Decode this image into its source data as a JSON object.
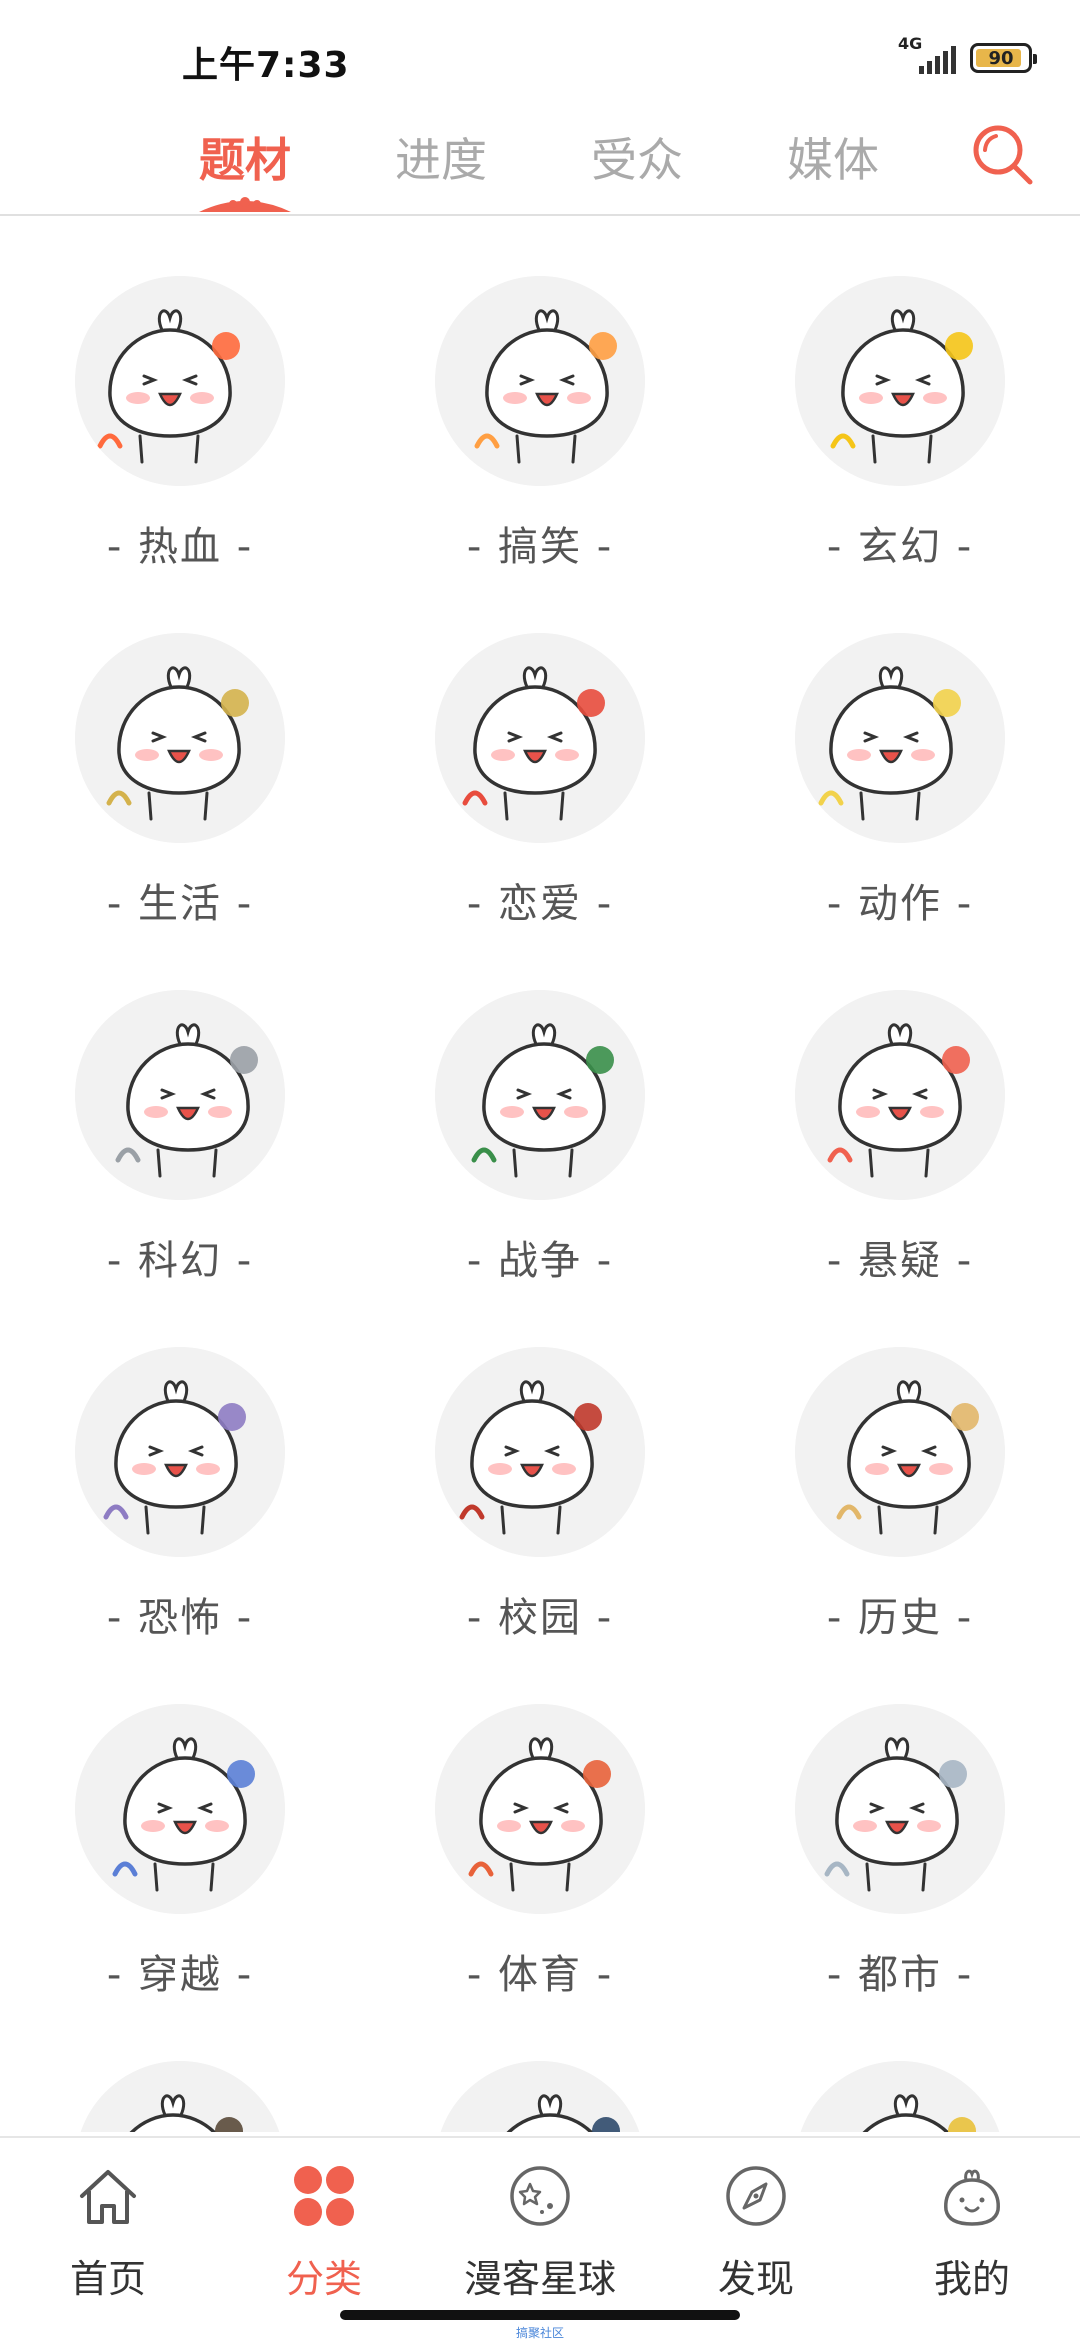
{
  "status_bar": {
    "time": "上午7:33",
    "network": "4G",
    "battery": "90",
    "battery_level": 0.9
  },
  "tabs": [
    {
      "label": "题材",
      "active": true
    },
    {
      "label": "进度",
      "active": false
    },
    {
      "label": "受众",
      "active": false
    },
    {
      "label": "媒体",
      "active": false
    }
  ],
  "colors": {
    "accent": "#f0614f",
    "tab_inactive": "#aaaaaa",
    "label": "#555555",
    "avatar_bg": "#f2f2f2"
  },
  "categories": [
    {
      "label": "- 热血 -",
      "icon": "hot-blooded-mascot-icon"
    },
    {
      "label": "- 搞笑 -",
      "icon": "comedy-mascot-icon"
    },
    {
      "label": "- 玄幻 -",
      "icon": "fantasy-mascot-icon"
    },
    {
      "label": "- 生活 -",
      "icon": "daily-life-mascot-icon"
    },
    {
      "label": "- 恋爱 -",
      "icon": "romance-mascot-icon"
    },
    {
      "label": "- 动作 -",
      "icon": "action-mascot-icon"
    },
    {
      "label": "- 科幻 -",
      "icon": "scifi-mascot-icon"
    },
    {
      "label": "- 战争 -",
      "icon": "war-mascot-icon"
    },
    {
      "label": "- 悬疑 -",
      "icon": "mystery-mascot-icon"
    },
    {
      "label": "- 恐怖 -",
      "icon": "horror-mascot-icon"
    },
    {
      "label": "- 校园 -",
      "icon": "campus-mascot-icon"
    },
    {
      "label": "- 历史 -",
      "icon": "history-mascot-icon"
    },
    {
      "label": "- 穿越 -",
      "icon": "time-travel-mascot-icon"
    },
    {
      "label": "- 体育 -",
      "icon": "sports-mascot-icon"
    },
    {
      "label": "- 都市 -",
      "icon": "urban-mascot-icon"
    },
    {
      "label": "",
      "icon": "partial-mascot-icon"
    },
    {
      "label": "",
      "icon": "partial-mascot-icon"
    },
    {
      "label": "",
      "icon": "partial-mascot-icon"
    }
  ],
  "bottom_nav": [
    {
      "label": "首页",
      "icon": "home-icon",
      "active": false
    },
    {
      "label": "分类",
      "icon": "category-icon",
      "active": true
    },
    {
      "label": "漫客星球",
      "icon": "planet-icon",
      "active": false
    },
    {
      "label": "发现",
      "icon": "compass-icon",
      "active": false
    },
    {
      "label": "我的",
      "icon": "profile-mascot-icon",
      "active": false
    }
  ],
  "watermark": "搞聚社区"
}
